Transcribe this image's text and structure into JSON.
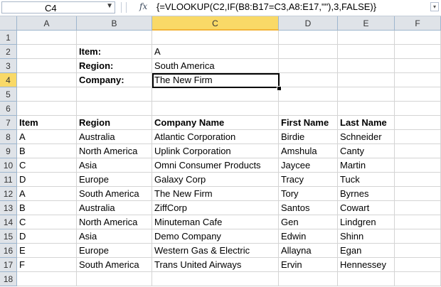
{
  "formula_bar": {
    "name_box": "C4",
    "fx_symbol": "fx",
    "formula": "{=VLOOKUP(C2,IF(B8:B17=C3,A8:E17,\"\"),3,FALSE)}"
  },
  "columns": [
    "A",
    "B",
    "C",
    "D",
    "E",
    "F"
  ],
  "rows": [
    "1",
    "2",
    "3",
    "4",
    "5",
    "6",
    "7",
    "8",
    "9",
    "10",
    "11",
    "12",
    "13",
    "14",
    "15",
    "16",
    "17",
    "18"
  ],
  "lookup": {
    "item_label": "Item:",
    "item_value": "A",
    "region_label": "Region:",
    "region_value": "South America",
    "company_label": "Company:",
    "company_value": "The New Firm"
  },
  "table": {
    "headers": [
      "Item",
      "Region",
      "Company Name",
      "First Name",
      "Last Name"
    ],
    "rows": [
      [
        "A",
        "Australia",
        "Atlantic Corporation",
        "Birdie",
        "Schneider"
      ],
      [
        "B",
        "North America",
        "Uplink Corporation",
        "Amshula",
        "Canty"
      ],
      [
        "C",
        "Asia",
        "Omni Consumer Products",
        "Jaycee",
        "Martin"
      ],
      [
        "D",
        "Europe",
        "Galaxy Corp",
        "Tracy",
        "Tuck"
      ],
      [
        "A",
        "South America",
        "The New Firm",
        "Tory",
        "Byrnes"
      ],
      [
        "B",
        "Australia",
        "ZiffCorp",
        "Santos",
        "Cowart"
      ],
      [
        "C",
        "North America",
        "Minuteman Cafe",
        "Gen",
        "Lindgren"
      ],
      [
        "D",
        "Asia",
        "Demo Company",
        "Edwin",
        "Shinn"
      ],
      [
        "E",
        "Europe",
        "Western Gas & Electric",
        "Allayna",
        "Egan"
      ],
      [
        "F",
        "South America",
        "Trans United Airways",
        "Ervin",
        "Hennessey"
      ]
    ]
  },
  "colors": {
    "header_bg": "#dfe3e8",
    "selected_header": "#f9d967",
    "gridline": "#d4d4d4"
  }
}
